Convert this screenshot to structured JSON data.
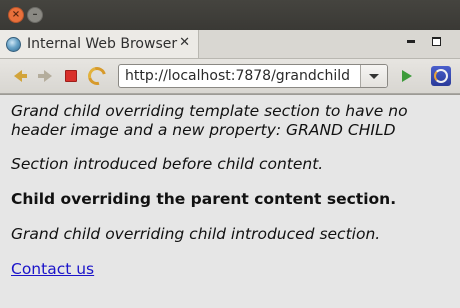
{
  "window": {
    "close_glyph": "×",
    "minimize_glyph": "–"
  },
  "tab": {
    "title": "Internal Web Browser",
    "close_glyph": "✕",
    "icon": "globe-icon"
  },
  "toolbar": {
    "back_icon": "back-arrow-icon",
    "forward_icon": "forward-arrow-icon",
    "stop_icon": "stop-icon",
    "refresh_icon": "refresh-icon",
    "url": "http://localhost:7878/grandchild",
    "go_icon": "go-icon",
    "eclipse_icon": "eclipse-icon"
  },
  "page": {
    "p1": "Grand child overriding template section to have no header image and a new property: GRAND CHILD",
    "p2": "Section introduced before child content.",
    "p3": "Child overriding the parent content section.",
    "p4": "Grand child overriding child introduced section.",
    "link": "Contact us"
  },
  "colors": {
    "content_bg": "#e6e6e6",
    "link": "#1b14c9",
    "titlebar": "#3c3b37",
    "close_button": "#e9703b"
  }
}
